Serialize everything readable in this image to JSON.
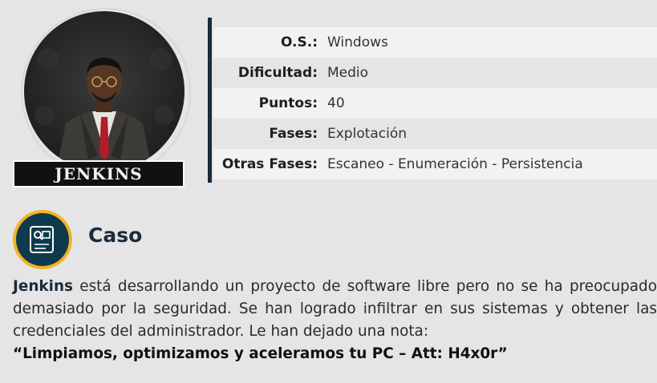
{
  "avatar": {
    "name": "JENKINS"
  },
  "info": [
    {
      "label": "O.S.:",
      "value": "Windows"
    },
    {
      "label": "Dificultad:",
      "value": "Medio"
    },
    {
      "label": "Puntos:",
      "value": "40"
    },
    {
      "label": "Fases:",
      "value": "Explotación"
    },
    {
      "label": "Otras Fases:",
      "value": "Escaneo - Enumeración - Persistencia"
    }
  ],
  "case": {
    "title": "Caso",
    "name_bold": "Jenkins",
    "text": " está desarrollando un proyecto de software libre pero no se ha preocupado demasiado por la seguridad. Se han logrado infiltrar en sus sistemas y obtener las credenciales del administrador. Le han dejado una nota:",
    "quote": "“Limpiamos, optimizamos y aceleramos tu PC – Att: H4x0r”"
  },
  "colors": {
    "accent_gold": "#f2b422",
    "icon_navy": "#0e3a4c",
    "divider": "#1a2a3a"
  }
}
